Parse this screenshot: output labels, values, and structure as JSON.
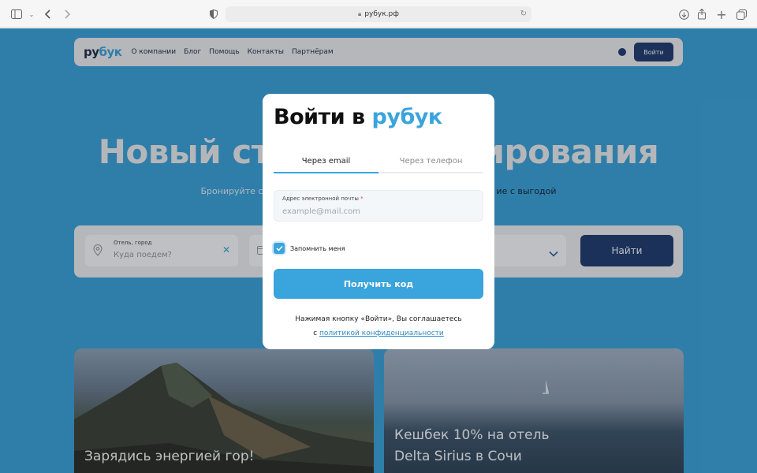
{
  "browser": {
    "url": "рубук.рф"
  },
  "nav": {
    "logo_prefix": "ру",
    "logo_accent": "бук",
    "links": [
      "О компании",
      "Блог",
      "Помощь",
      "Контакты",
      "Партнёрам"
    ],
    "login_label": "Войти"
  },
  "hero": {
    "title_left": "Новый ст",
    "title_right": "ирования",
    "subtitle_left": "Бронируйте с",
    "subtitle_right": "ие с выгодой"
  },
  "search": {
    "city_label": "Отель, город",
    "city_placeholder": "Куда поедем?",
    "find_label": "Найти"
  },
  "cards": [
    {
      "title": "Зарядись энергией гор!"
    },
    {
      "title_line1": "Кешбек 10% на отель",
      "title_line2": "Delta Sirius в Сочи"
    }
  ],
  "modal": {
    "title_prefix": "Войти в ",
    "title_accent": "рубук",
    "tab_email": "Через email",
    "tab_phone": "Через телефон",
    "email_label": "Адрес электронной почты",
    "email_required_mark": "*",
    "email_placeholder": "example@mail.com",
    "email_value": "",
    "remember_label": "Запомнить меня",
    "remember_checked": true,
    "submit_label": "Получить код",
    "agree_line1": "Нажимая кнопку «Войти», Вы соглашаетесь",
    "agree_prefix": "с ",
    "agree_link": "политикой конфиденциальности"
  },
  "colors": {
    "accent": "#3aa4dc",
    "brand_dark": "#1e3a6e",
    "required": "#e23a3a"
  }
}
